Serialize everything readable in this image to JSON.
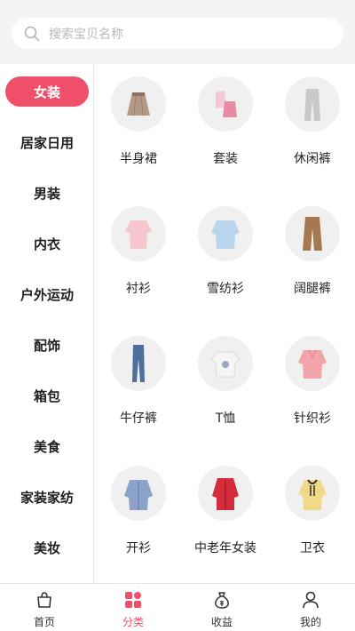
{
  "search": {
    "placeholder": "搜索宝贝名称"
  },
  "sidebar": {
    "categories": [
      {
        "label": "女装",
        "active": true
      },
      {
        "label": "居家日用",
        "active": false
      },
      {
        "label": "男装",
        "active": false
      },
      {
        "label": "内衣",
        "active": false
      },
      {
        "label": "户外运动",
        "active": false
      },
      {
        "label": "配饰",
        "active": false
      },
      {
        "label": "箱包",
        "active": false
      },
      {
        "label": "美食",
        "active": false
      },
      {
        "label": "家装家纺",
        "active": false
      },
      {
        "label": "美妆",
        "active": false
      }
    ]
  },
  "grid": {
    "items": [
      {
        "label": "半身裙",
        "icon": "skirt-icon"
      },
      {
        "label": "套装",
        "icon": "outfit-set-icon"
      },
      {
        "label": "休闲裤",
        "icon": "casual-pants-icon"
      },
      {
        "label": "衬衫",
        "icon": "shirt-icon"
      },
      {
        "label": "雪纺衫",
        "icon": "chiffon-blouse-icon"
      },
      {
        "label": "阔腿裤",
        "icon": "wide-leg-pants-icon"
      },
      {
        "label": "牛仔裤",
        "icon": "jeans-icon"
      },
      {
        "label": "T恤",
        "icon": "tshirt-icon"
      },
      {
        "label": "针织衫",
        "icon": "knit-sweater-icon"
      },
      {
        "label": "开衫",
        "icon": "cardigan-icon"
      },
      {
        "label": "中老年女装",
        "icon": "padded-jacket-icon"
      },
      {
        "label": "卫衣",
        "icon": "hoodie-icon"
      }
    ]
  },
  "tabbar": {
    "tabs": [
      {
        "label": "首页",
        "icon": "shopping-bag-icon",
        "active": false
      },
      {
        "label": "分类",
        "icon": "category-grid-icon",
        "active": true
      },
      {
        "label": "收益",
        "icon": "money-bag-icon",
        "active": false
      },
      {
        "label": "我的",
        "icon": "user-icon",
        "active": false
      }
    ]
  },
  "colors": {
    "accent": "#ef4f69",
    "background": "#f4f4f4",
    "text": "#222222"
  }
}
